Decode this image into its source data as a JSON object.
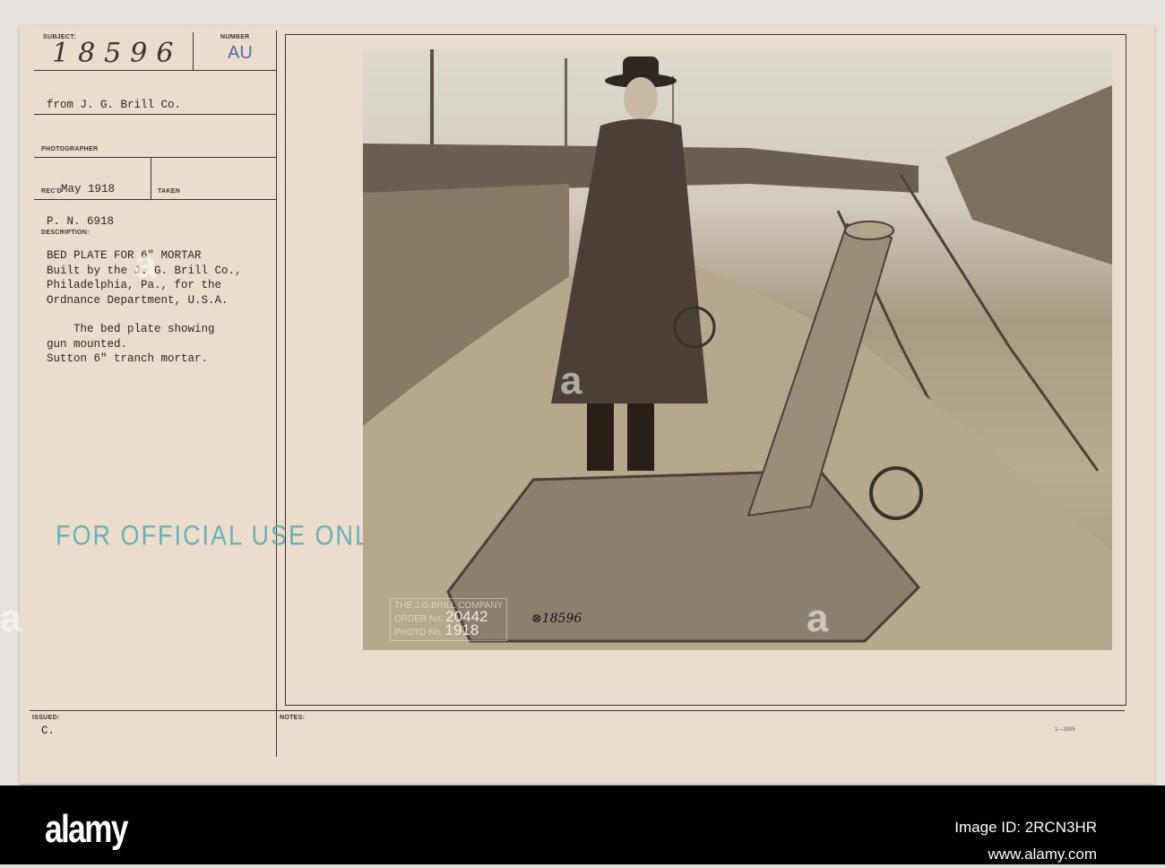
{
  "card": {
    "subject_label": "SUBJECT:",
    "subject_number": "18596",
    "number_label": "NUMBER",
    "number_stamp": "AU",
    "source": "from J. G. Brill Co.",
    "photographer_label": "PHOTOGRAPHER",
    "recd_label": "REC'D",
    "recd_value": "May 1918",
    "taken_label": "TAKEN",
    "pn": "P. N. 6918",
    "description_label": "DESCRIPTION:",
    "description_lines": [
      "BED PLATE FOR 6\" MORTAR",
      "Built by the J. G. Brill Co.,",
      "Philadelphia, Pa., for the",
      "Ordnance Department, U.S.A.",
      "",
      "    The bed plate showing",
      "gun mounted.",
      "Sutton 6\" tranch mortar."
    ],
    "official_stamp": "FOR OFFICIAL USE ONLY",
    "issued_label": "ISSUED:",
    "issued_value": "C.",
    "notes_label": "NOTES:",
    "form_number": "1—2005"
  },
  "photo": {
    "plate_line1": "THE J.G.BRILL COMPANY",
    "plate_order_label": "ORDER No.",
    "plate_order": "20442",
    "plate_photo_label": "PHOTO No.",
    "plate_photo": "1918",
    "negative_number": "⊗18596"
  },
  "watermark": {
    "brand": "alamy",
    "image_id": "Image ID: 2RCN3HR",
    "url": "www.alamy.com",
    "mark": "a"
  }
}
